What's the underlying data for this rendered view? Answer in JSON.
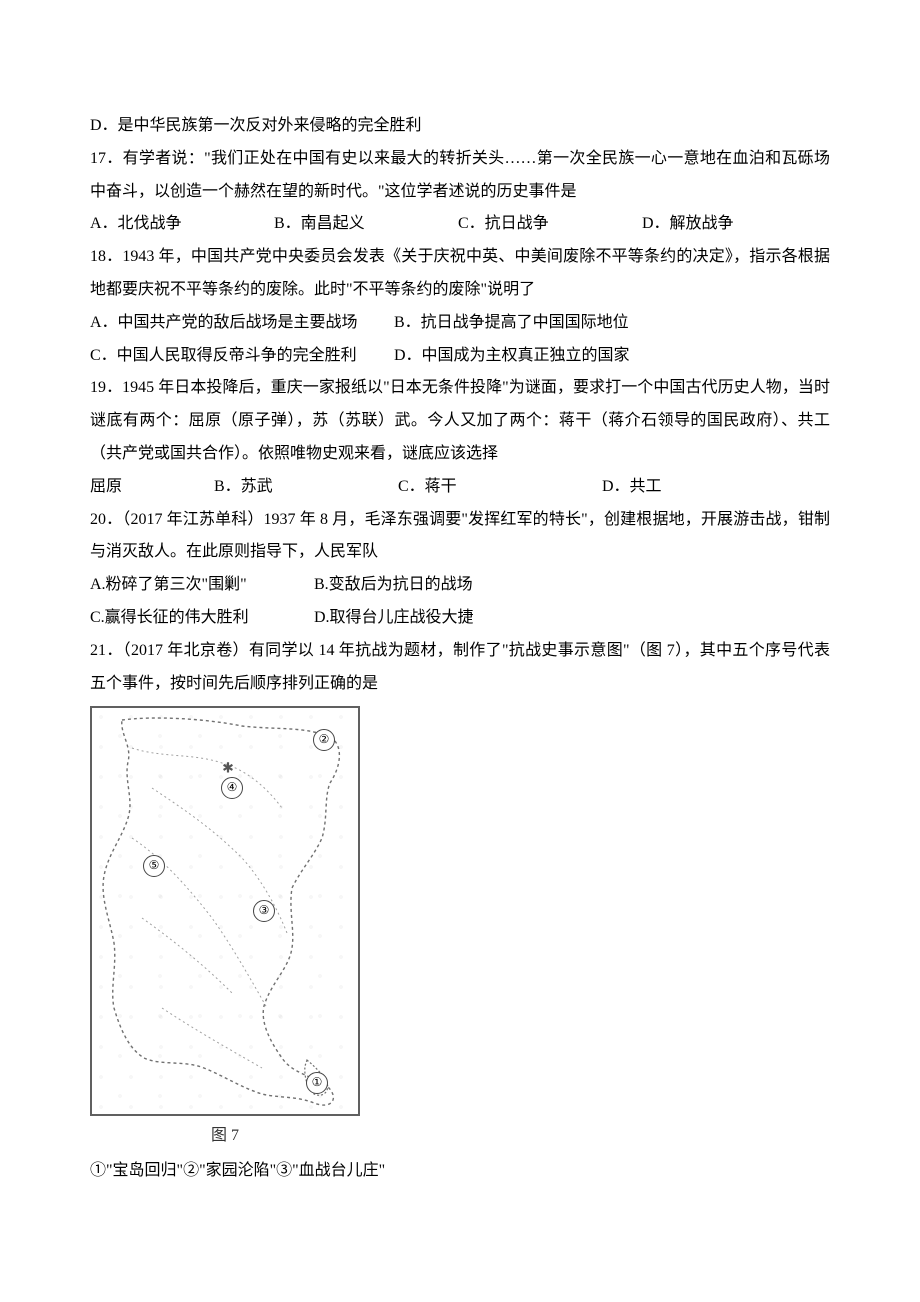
{
  "q16": {
    "optD": "D．是中华民族第一次反对外来侵略的完全胜利"
  },
  "q17": {
    "stem": "17．有学者说：\"我们正处在中国有史以来最大的转折关头……第一次全民族一心一意地在血泊和瓦砾场中奋斗，以创造一个赫然在望的新时代。\"这位学者述说的历史事件是",
    "A": "A．北伐战争",
    "B": "B．南昌起义",
    "C": "C．抗日战争",
    "D": "D．解放战争"
  },
  "q18": {
    "stem": "18．1943 年，中国共产党中央委员会发表《关于庆祝中英、中美间废除不平等条约的决定》，指示各根据地都要庆祝不平等条约的废除。此时\"不平等条约的废除\"说明了",
    "A": "A．中国共产党的敌后战场是主要战场",
    "B": "B．抗日战争提高了中国国际地位",
    "C": "C．中国人民取得反帝斗争的完全胜利",
    "D": "D．中国成为主权真正独立的国家"
  },
  "q19": {
    "stem": "19．1945 年日本投降后，重庆一家报纸以\"日本无条件投降\"为谜面，要求打一个中国古代历史人物，当时谜底有两个：屈原（原子弹），苏（苏联）武。今人又加了两个：蒋干（蒋介石领导的国民政府）、共工（共产党或国共合作）。依照唯物史观来看，谜底应该选择",
    "A": "屈原",
    "B": "B．苏武",
    "C": "C．蒋干",
    "D": "D．共工"
  },
  "q20": {
    "stem": "20．（2017 年江苏单科）1937 年 8 月，毛泽东强调要\"发挥红军的特长\"，创建根据地，开展游击战，钳制与消灭敌人。在此原则指导下，人民军队",
    "A": "A.粉碎了第三次\"围剿\"",
    "B": "B.变敌后为抗日的战场",
    "C": "C.赢得长征的伟大胜利",
    "D": "D.取得台儿庄战役大捷"
  },
  "q21": {
    "stem": "21．（2017 年北京卷）有同学以 14 年抗战为题材，制作了\"抗战史事示意图\"（图 7），其中五个序号代表五个事件，按时间先后顺序排列正确的是",
    "caption": "图 7",
    "markers": {
      "m1": "①",
      "m2": "②",
      "m3": "③",
      "m4": "④",
      "m5": "⑤"
    },
    "legend": "①\"宝岛回归\"②\"家园沦陷\"③\"血战台儿庄\""
  }
}
